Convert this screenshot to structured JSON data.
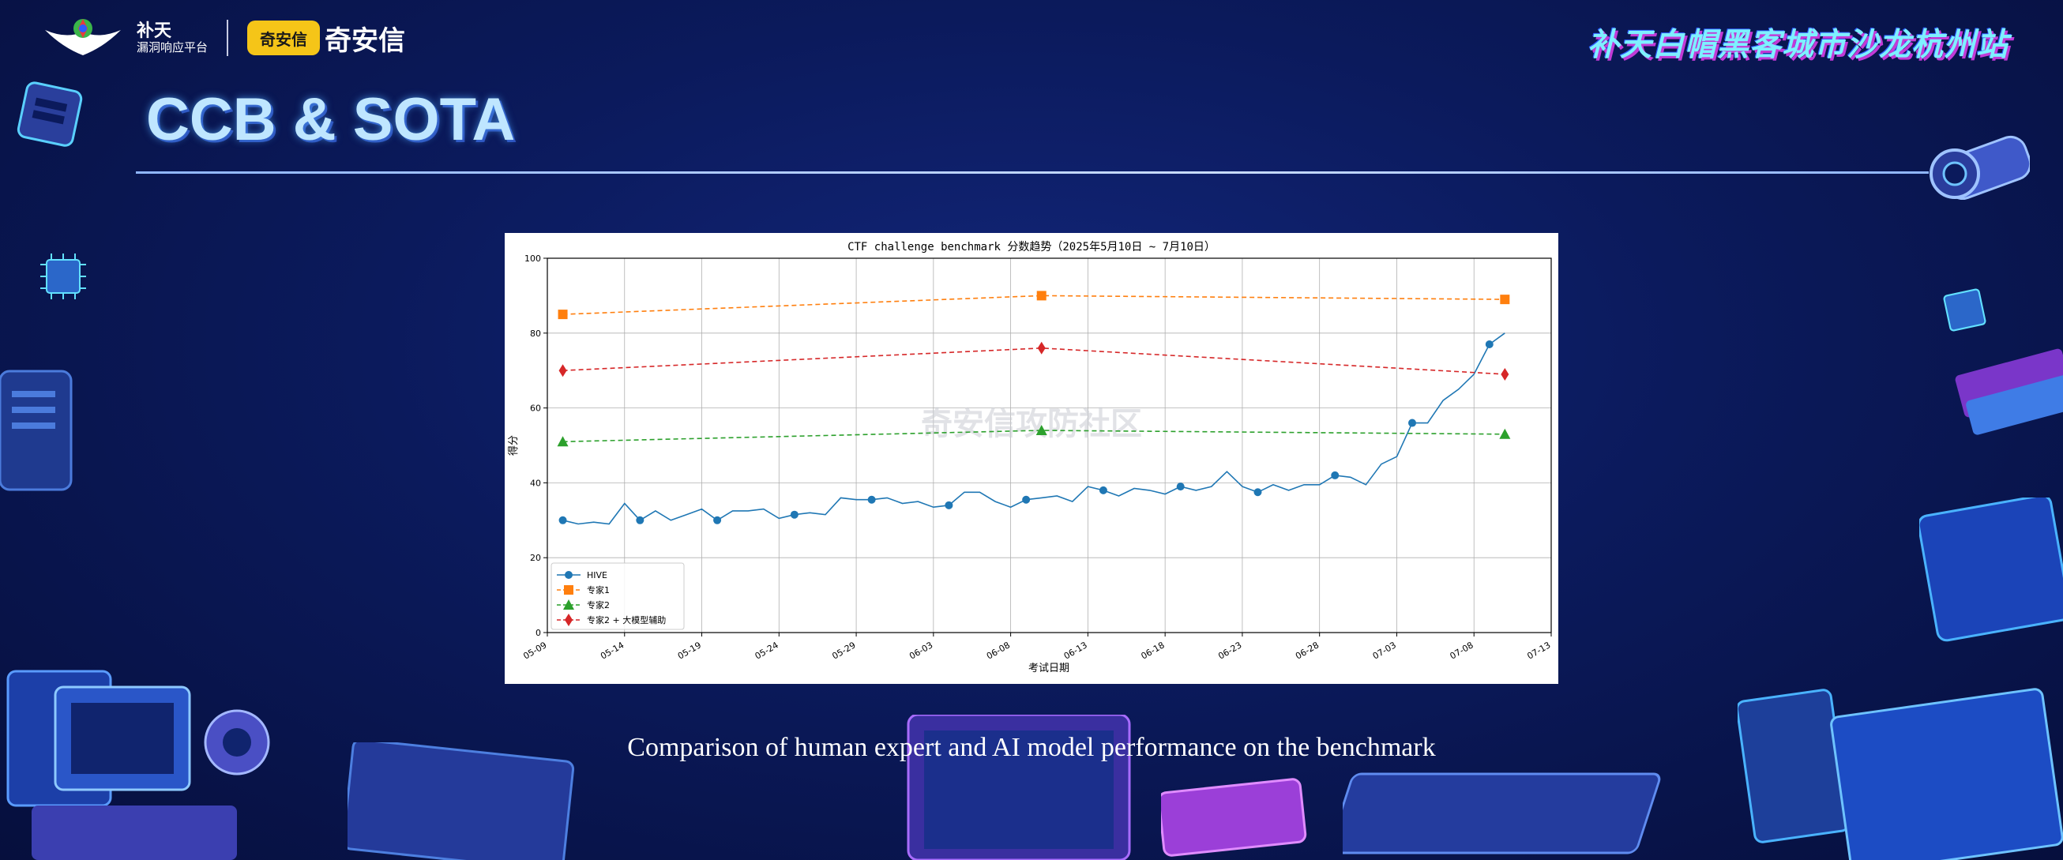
{
  "header": {
    "brand_cn": "补天",
    "brand_sub": "漏洞响应平台",
    "partner_badge": "奇安信",
    "partner_name": "奇安信",
    "event_title": "补天白帽黑客城市沙龙杭州站"
  },
  "slide": {
    "title": "CCB & SOTA",
    "caption": "Comparison of human expert and AI model performance on the benchmark",
    "watermark": "奇安信攻防社区"
  },
  "colors": {
    "hive": "#1f77b4",
    "expert1": "#ff7f0e",
    "expert2": "#2ca02c",
    "expert2_ai": "#d62728"
  },
  "chart_data": {
    "type": "line",
    "title": "CTF challenge benchmark 分数趋势（2025年5月10日 ~ 7月10日）",
    "xlabel": "考试日期",
    "ylabel": "得分",
    "ylim": [
      0,
      100
    ],
    "yticks": [
      0,
      20,
      40,
      60,
      80,
      100
    ],
    "xlim": [
      "2025-05-09",
      "2025-07-13"
    ],
    "xticks": [
      "2025-05-09",
      "2025-05-14",
      "2025-05-19",
      "2025-05-24",
      "2025-05-29",
      "2025-06-03",
      "2025-06-08",
      "2025-06-13",
      "2025-06-18",
      "2025-06-23",
      "2025-06-28",
      "2025-07-03",
      "2025-07-08",
      "2025-07-13"
    ],
    "xtick_labels": [
      "05-09",
      "05-14",
      "05-19",
      "05-24",
      "05-29",
      "06-03",
      "06-08",
      "06-13",
      "06-18",
      "06-23",
      "06-28",
      "07-03",
      "07-08",
      "07-13"
    ],
    "grid": true,
    "legend_position": "lower-left",
    "series": [
      {
        "name": "HIVE",
        "style": "solid",
        "marker": "circle",
        "marker_every": 5,
        "x": [
          "2025-05-10",
          "2025-05-11",
          "2025-05-12",
          "2025-05-13",
          "2025-05-14",
          "2025-05-15",
          "2025-05-16",
          "2025-05-17",
          "2025-05-18",
          "2025-05-19",
          "2025-05-20",
          "2025-05-21",
          "2025-05-22",
          "2025-05-23",
          "2025-05-24",
          "2025-05-25",
          "2025-05-26",
          "2025-05-27",
          "2025-05-28",
          "2025-05-29",
          "2025-05-30",
          "2025-05-31",
          "2025-06-01",
          "2025-06-02",
          "2025-06-03",
          "2025-06-04",
          "2025-06-05",
          "2025-06-06",
          "2025-06-07",
          "2025-06-08",
          "2025-06-09",
          "2025-06-10",
          "2025-06-11",
          "2025-06-12",
          "2025-06-13",
          "2025-06-14",
          "2025-06-15",
          "2025-06-16",
          "2025-06-17",
          "2025-06-18",
          "2025-06-19",
          "2025-06-20",
          "2025-06-21",
          "2025-06-22",
          "2025-06-23",
          "2025-06-24",
          "2025-06-25",
          "2025-06-26",
          "2025-06-27",
          "2025-06-28",
          "2025-06-29",
          "2025-06-30",
          "2025-07-01",
          "2025-07-02",
          "2025-07-03",
          "2025-07-04",
          "2025-07-05",
          "2025-07-06",
          "2025-07-07",
          "2025-07-08",
          "2025-07-09",
          "2025-07-10"
        ],
        "values": [
          30,
          29,
          29.5,
          29,
          34.5,
          30,
          32.5,
          30,
          31.5,
          33,
          30,
          32.5,
          32.5,
          33,
          30.5,
          31.5,
          32,
          31.5,
          36,
          35.5,
          35.5,
          36,
          34.5,
          35,
          33.5,
          34,
          37.5,
          37.5,
          35,
          33.5,
          35.5,
          36,
          36.5,
          35,
          39,
          38,
          36.5,
          38.5,
          38,
          37,
          39,
          38,
          39,
          43,
          39,
          37.5,
          39.5,
          38,
          39.5,
          39.5,
          42,
          41.5,
          39.5,
          45,
          47,
          56,
          56,
          62,
          65,
          69,
          77,
          80
        ]
      },
      {
        "name": "专家1",
        "style": "dashed",
        "marker": "square",
        "x": [
          "2025-05-10",
          "2025-06-10",
          "2025-07-10"
        ],
        "values": [
          85,
          90,
          89
        ]
      },
      {
        "name": "专家2",
        "style": "dashed",
        "marker": "triangle",
        "x": [
          "2025-05-10",
          "2025-06-10",
          "2025-07-10"
        ],
        "values": [
          51,
          54,
          53
        ]
      },
      {
        "name": "专家2 + 大模型辅助",
        "style": "dashed",
        "marker": "diamond",
        "x": [
          "2025-05-10",
          "2025-06-10",
          "2025-07-10"
        ],
        "values": [
          70,
          76,
          69
        ]
      }
    ]
  }
}
